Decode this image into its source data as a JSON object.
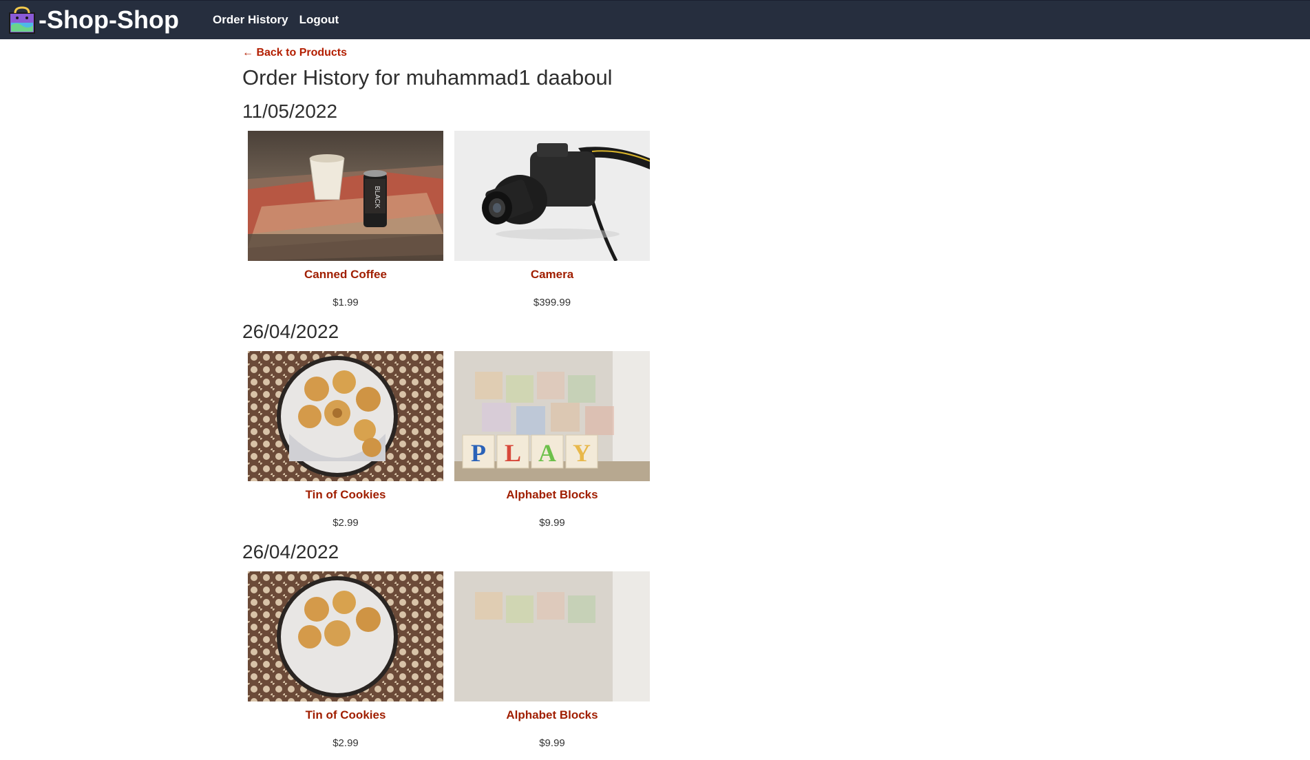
{
  "nav": {
    "brand": "-Shop-Shop",
    "links": [
      "Order History",
      "Logout"
    ]
  },
  "page": {
    "back_link": "← Back to Products",
    "title": "Order History for muhammad1 daaboul"
  },
  "orders": [
    {
      "date": "11/05/2022",
      "items": [
        {
          "name": "Canned Coffee",
          "price": "$1.99"
        },
        {
          "name": "Camera",
          "price": "$399.99"
        }
      ]
    },
    {
      "date": "26/04/2022",
      "items": [
        {
          "name": "Tin of Cookies",
          "price": "$2.99"
        },
        {
          "name": "Alphabet Blocks",
          "price": "$9.99"
        }
      ]
    },
    {
      "date": "26/04/2022",
      "items": [
        {
          "name": "Tin of Cookies",
          "price": "$2.99"
        },
        {
          "name": "Alphabet Blocks",
          "price": "$9.99"
        }
      ]
    }
  ],
  "colors": {
    "navbar": "#262e3e",
    "accent_link": "#b31e00",
    "text": "#2e2e2e"
  },
  "icons": {
    "brand": "shopping-bag-icon"
  }
}
